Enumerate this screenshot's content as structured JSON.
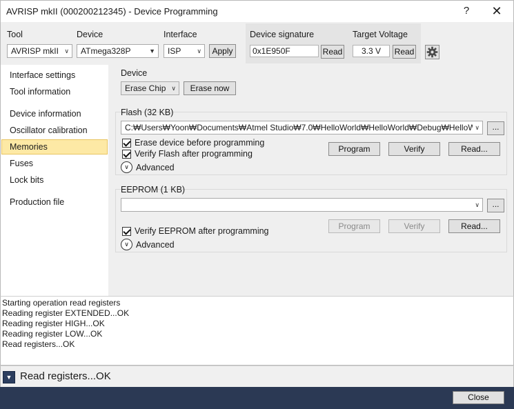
{
  "window": {
    "title": "AVRISP mkII (000200212345) - Device Programming",
    "help_label": "?",
    "close_label": "✕"
  },
  "toolbar": {
    "tool_label": "Tool",
    "tool_value": "AVRISP mkII",
    "device_label": "Device",
    "device_value": "ATmega328P",
    "interface_label": "Interface",
    "interface_value": "ISP",
    "apply_label": "Apply",
    "signature_label": "Device signature",
    "signature_value": "0x1E950F",
    "signature_read_label": "Read",
    "voltage_label": "Target Voltage",
    "voltage_value": "3.3 V",
    "voltage_read_label": "Read",
    "settings_icon": "gear-icon"
  },
  "sidebar": {
    "items": [
      {
        "label": "Interface settings",
        "selected": false
      },
      {
        "label": "Tool information",
        "selected": false
      },
      {
        "label": "Device information",
        "selected": false
      },
      {
        "label": "Oscillator calibration",
        "selected": false
      },
      {
        "label": "Memories",
        "selected": true
      },
      {
        "label": "Fuses",
        "selected": false
      },
      {
        "label": "Lock bits",
        "selected": false
      },
      {
        "label": "Production file",
        "selected": false
      }
    ]
  },
  "device_group": {
    "label": "Device",
    "erase_mode": "Erase Chip",
    "erase_now_label": "Erase now"
  },
  "flash_group": {
    "label": "Flash (32 KB)",
    "file_path": "C:₩Users₩Yoon₩Documents₩Atmel Studio₩7.0₩HelloWorld₩HelloWorld₩Debug₩HelloW",
    "browse_label": "...",
    "erase_before_label": "Erase device before programming",
    "verify_after_label": "Verify Flash after programming",
    "program_label": "Program",
    "verify_label": "Verify",
    "read_label": "Read...",
    "advanced_label": "Advanced"
  },
  "eeprom_group": {
    "label": "EEPROM (1 KB)",
    "file_path": "",
    "browse_label": "...",
    "verify_after_label": "Verify EEPROM after programming",
    "program_label": "Program",
    "verify_label": "Verify",
    "read_label": "Read...",
    "advanced_label": "Advanced"
  },
  "log": {
    "lines": [
      "Starting operation read registers",
      "Reading register EXTENDED...OK",
      "Reading register HIGH...OK",
      "Reading register LOW...OK",
      "Read registers...OK"
    ]
  },
  "status": {
    "message": "Read registers...OK"
  },
  "footer": {
    "close_label": "Close"
  },
  "colors": {
    "selection": "#fde9a5",
    "footer": "#2b3954",
    "panel": "#efefef"
  }
}
